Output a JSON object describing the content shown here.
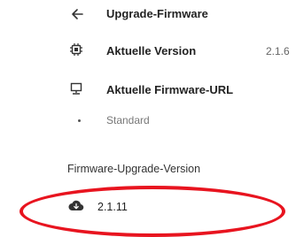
{
  "header": {
    "title": "Upgrade-Firmware",
    "back_icon": "arrow-left-icon"
  },
  "current_version": {
    "icon": "chip-icon",
    "label": "Aktuelle Version",
    "value": "2.1.6"
  },
  "firmware_url": {
    "icon": "monitor-icon",
    "label": "Aktuelle Firmware-URL"
  },
  "standard": {
    "label": "Standard"
  },
  "upgrade_section": {
    "title": "Firmware-Upgrade-Version"
  },
  "available_version": {
    "icon": "cloud-download-icon",
    "value": "2.1.11"
  },
  "colors": {
    "accent": "#e8141f",
    "text": "#222222"
  }
}
